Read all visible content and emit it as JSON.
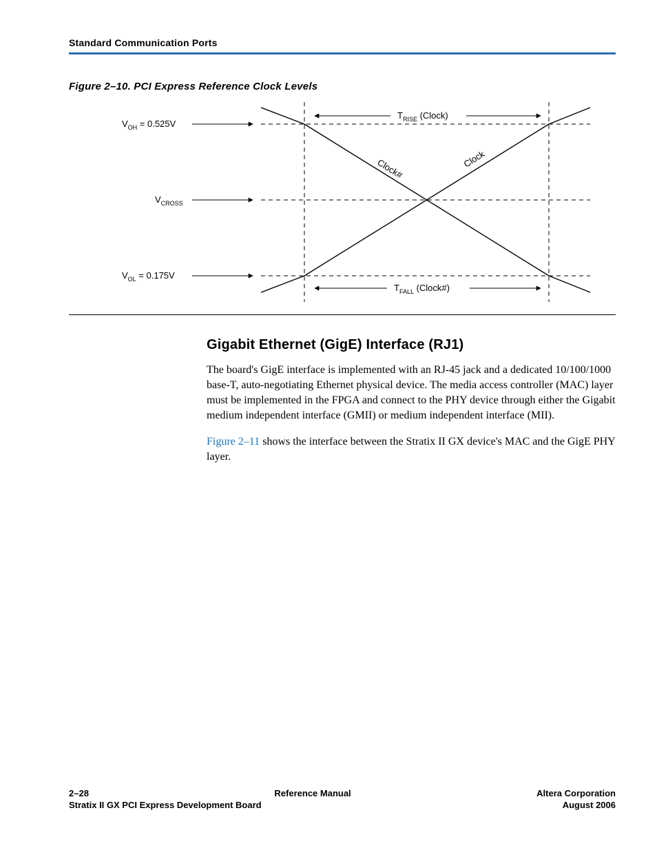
{
  "running_head": "Standard Communication Ports",
  "figure": {
    "caption": "Figure 2–10. PCI Express Reference Clock Levels",
    "labels": {
      "voh": "V",
      "voh_sub": "OH",
      "voh_val": " = 0.525V",
      "vcross": "V",
      "vcross_sub": "CROSS",
      "vol": "V",
      "vol_sub": "OL",
      "vol_val": " = 0.175V",
      "trise": "T",
      "trise_sub": "RISE",
      "trise_after": " (Clock)",
      "tfall": "T",
      "tfall_sub": "FALL",
      "tfall_after": " (Clock#)",
      "clock_hash": "Clock#",
      "clock": "Clock"
    }
  },
  "section_heading": "Gigabit Ethernet (GigE) Interface (RJ1)",
  "para1": "The board's GigE interface is implemented with an RJ-45 jack and a dedicated 10/100/1000 base-T, auto-negotiating Ethernet physical device. The media access controller (MAC) layer must be implemented in the FPGA and connect to the PHY device through either the Gigabit medium independent interface (GMII) or medium independent interface (MII).",
  "para2_link": "Figure 2–11",
  "para2_rest": " shows the interface between the Stratix II GX device's MAC and the GigE PHY layer.",
  "footer": {
    "page_number": "2–28",
    "center": "Reference Manual",
    "right_top": "Altera Corporation",
    "left_bottom": "Stratix II GX PCI Express Development Board",
    "right_bottom": "August 2006"
  }
}
